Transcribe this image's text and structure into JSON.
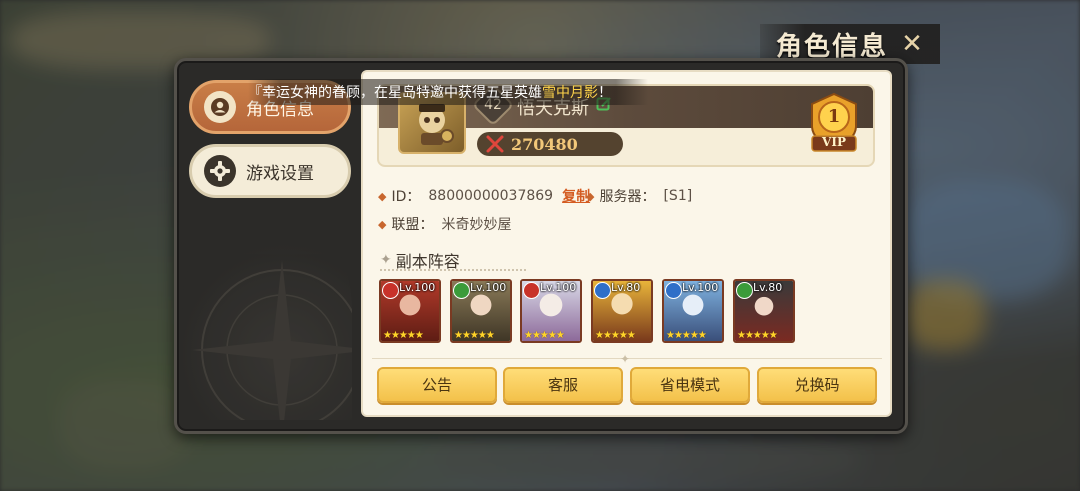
{
  "window": {
    "title": "角色信息"
  },
  "sidebar": {
    "items": [
      {
        "label": "角色信息",
        "icon": "person-icon",
        "active": true
      },
      {
        "label": "游戏设置",
        "icon": "gear-icon",
        "active": false
      }
    ]
  },
  "ticker": {
    "prefix": "『幸运女神的眷顾，在星岛特邀中获得五星英雄",
    "highlight": "雪中月影",
    "suffix": "！"
  },
  "profile": {
    "level": "42",
    "name": "悟天克斯",
    "power": "270480",
    "vip_level": "1",
    "vip_label": "VIP"
  },
  "info": {
    "id_label": "ID：",
    "id_value": "88000000037869",
    "copy_label": "复制",
    "server_label": "服务器：",
    "server_value": "[S1]",
    "alliance_label": "联盟：",
    "alliance_value": "米奇妙妙屋"
  },
  "lineup": {
    "title": "副本阵容",
    "heroes": [
      {
        "level": "Lv.100",
        "element": "fire",
        "element_color": "#c8322a",
        "stars": "★★★★★"
      },
      {
        "level": "Lv.100",
        "element": "nature",
        "element_color": "#3b9b3a",
        "stars": "★★★★★"
      },
      {
        "level": "Lv.100",
        "element": "fire",
        "element_color": "#c8322a",
        "stars": "★★★★★"
      },
      {
        "level": "Lv.80",
        "element": "water",
        "element_color": "#2f6fc8",
        "stars": "★★★★★"
      },
      {
        "level": "Lv.100",
        "element": "water",
        "element_color": "#2f6fc8",
        "stars": "★★★★★"
      },
      {
        "level": "Lv.80",
        "element": "nature",
        "element_color": "#3b9b3a",
        "stars": "★★★★★"
      }
    ]
  },
  "buttons": {
    "notice": "公告",
    "support": "客服",
    "power_save": "省电模式",
    "redeem": "兑换码"
  },
  "colors": {
    "accent": "#c97e47",
    "button": "#f3c14a",
    "highlight": "#ffd44a"
  }
}
